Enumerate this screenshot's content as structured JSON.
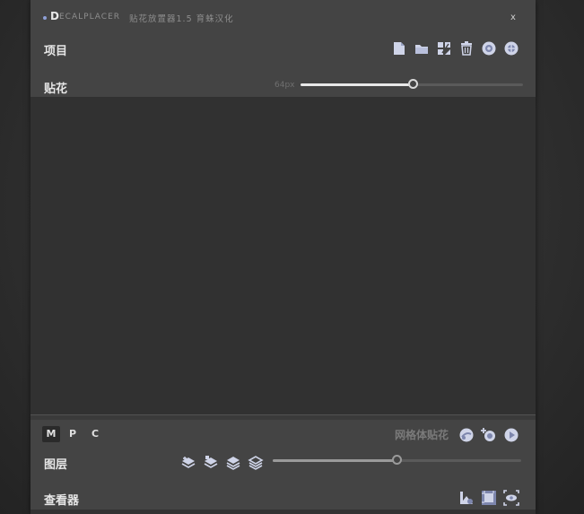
{
  "titlebar": {
    "title_initial": "D",
    "title_rest": "ECALPLACER",
    "subtitle": "贴花放置器1.5  育蛛汉化",
    "close_label": "x"
  },
  "project": {
    "label": "项目",
    "icons": [
      "new-file-icon",
      "open-folder-icon",
      "thumbnails-icon",
      "delete-icon",
      "globe-settings-icon",
      "globe-extra-icon"
    ]
  },
  "decals": {
    "label": "贴花",
    "size_label": "64px",
    "size_slider_fraction": 0.51
  },
  "modes": {
    "items": [
      "M",
      "P",
      "C"
    ],
    "active": "M"
  },
  "mesh_decal": {
    "label": "网格体贴花",
    "icons": [
      "mesh-globe-icon",
      "mesh-add-icon",
      "play-icon"
    ]
  },
  "layers": {
    "label": "图层",
    "icons": [
      "layer-stack-1-icon",
      "layer-stack-2-icon",
      "layer-stack-3-icon",
      "layer-stack-4-icon"
    ],
    "slider_fraction": 0.5
  },
  "viewer": {
    "label": "查看器",
    "icons": [
      "viewer-shape-icon",
      "viewer-frame-icon",
      "viewer-eye-icon"
    ]
  },
  "colors": {
    "accent": "#8e9fd6",
    "panel": "#444444",
    "canvas": "#313131"
  }
}
